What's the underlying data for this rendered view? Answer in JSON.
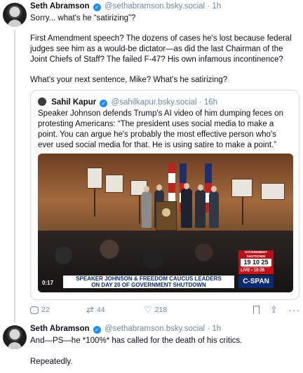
{
  "post1": {
    "author": {
      "name": "Seth Abramson",
      "handle": "@sethabramson.bsky.social",
      "time": "1h",
      "separator": "·"
    },
    "paragraphs": [
      "Sorry... what's he “satirizing”?",
      "First Amendment speech? The dozens of cases he's lost because federal judges see him as a would-be dictator—as did the last Chairman of the Joint Chiefs of Staff? The failed F-47? His own infamous incontinence?",
      "What's your next sentence, Mike? What's he satirizing?"
    ],
    "quote": {
      "author": {
        "name": "Sahil Kapur",
        "handle": "@sahilkapur.bsky.social",
        "time": "16h",
        "separator": "·"
      },
      "text": "Speaker Johnson defends Trump's AI video of him dumping feces on protesting Americans: “The president uses social media to make a point. You can argue he's probably the most effective person who's ever used social media for that. He is using satire to make a point.”",
      "video": {
        "banner_line1": "SPEAKER JOHNSON & FREEDOM CAUCUS LEADERS",
        "banner_line2": "ON DAY 20 OF GOVERNMENT SHUTDOWN",
        "network": "C-SPAN",
        "shutdown_label": "GOVERNMENT SHUTDOWN",
        "shutdown_counts": "19  10  25",
        "shutdown_units": "DAYS  HOURS  MINUTES",
        "live_label": "LIVE • 10:26",
        "duration": "0:17"
      }
    },
    "actions": {
      "replies": "22",
      "reposts": "44",
      "likes": "218"
    }
  },
  "post2": {
    "author": {
      "name": "Seth Abramson",
      "handle": "@sethabramson.bsky.social",
      "time": "1h",
      "separator": "·"
    },
    "paragraphs": [
      "And—PS—he *100%* has called for the death of his critics.",
      "Repeatedly."
    ]
  },
  "icons": {
    "verified": "verified-check-icon",
    "reply": "reply-icon",
    "repost": "repost-icon",
    "like": "heart-icon",
    "bookmark": "bookmark-icon",
    "share": "share-icon",
    "more": "more-icon"
  },
  "colors": {
    "accent": "#208bfe",
    "muted": "#6f869f",
    "border": "#d4dbe2",
    "cspan": "#0b2a6f",
    "live": "#c8101a"
  }
}
